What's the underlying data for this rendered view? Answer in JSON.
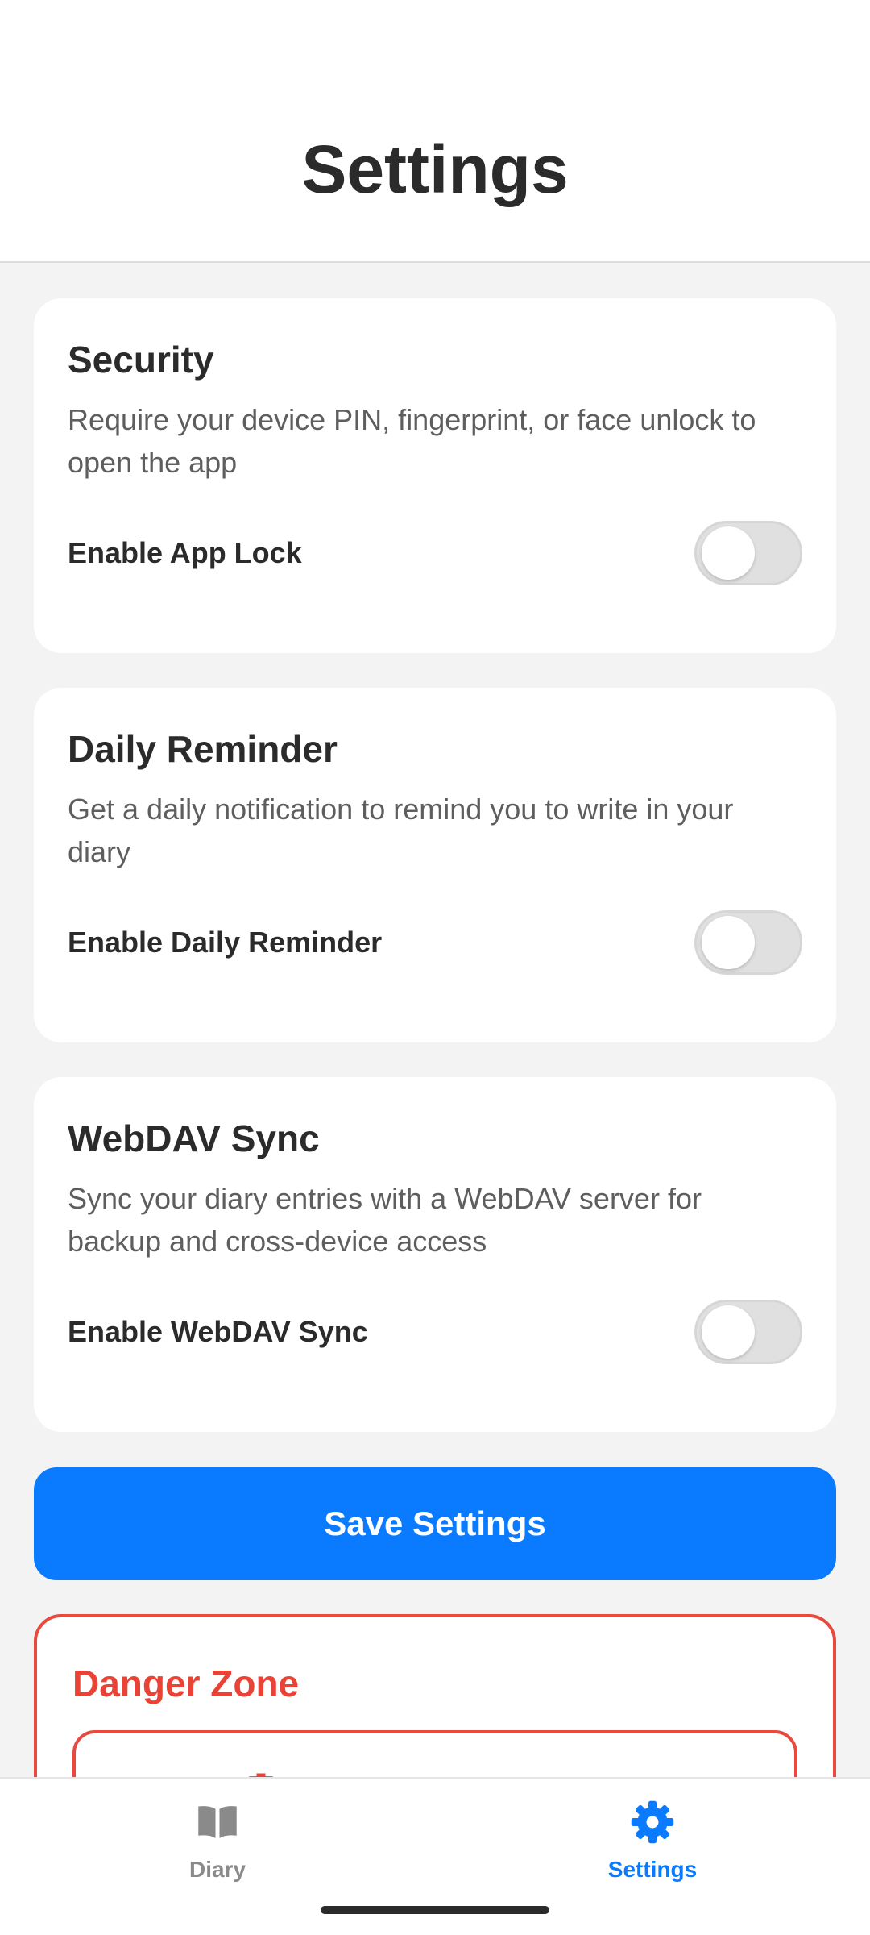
{
  "header": {
    "title": "Settings"
  },
  "sections": [
    {
      "title": "Security",
      "description": "Require your device PIN, fingerprint, or face unlock to open the app",
      "toggle_label": "Enable App Lock",
      "enabled": false
    },
    {
      "title": "Daily Reminder",
      "description": "Get a daily notification to remind you to write in your diary",
      "toggle_label": "Enable Daily Reminder",
      "enabled": false
    },
    {
      "title": "WebDAV Sync",
      "description": "Sync your diary entries with a WebDAV server for backup and cross-device access",
      "toggle_label": "Enable WebDAV Sync",
      "enabled": false
    }
  ],
  "save_button": {
    "label": "Save Settings"
  },
  "danger_zone": {
    "title": "Danger Zone",
    "button_icon": "trash-icon"
  },
  "bottom_nav": {
    "items": [
      {
        "label": "Diary",
        "icon": "book-icon",
        "active": false
      },
      {
        "label": "Settings",
        "icon": "gear-icon",
        "active": true
      }
    ]
  },
  "colors": {
    "accent": "#0a7bff",
    "danger": "#ea4335",
    "background": "#f3f3f3",
    "card": "#ffffff",
    "toggle_off": "#e0e0e0"
  }
}
